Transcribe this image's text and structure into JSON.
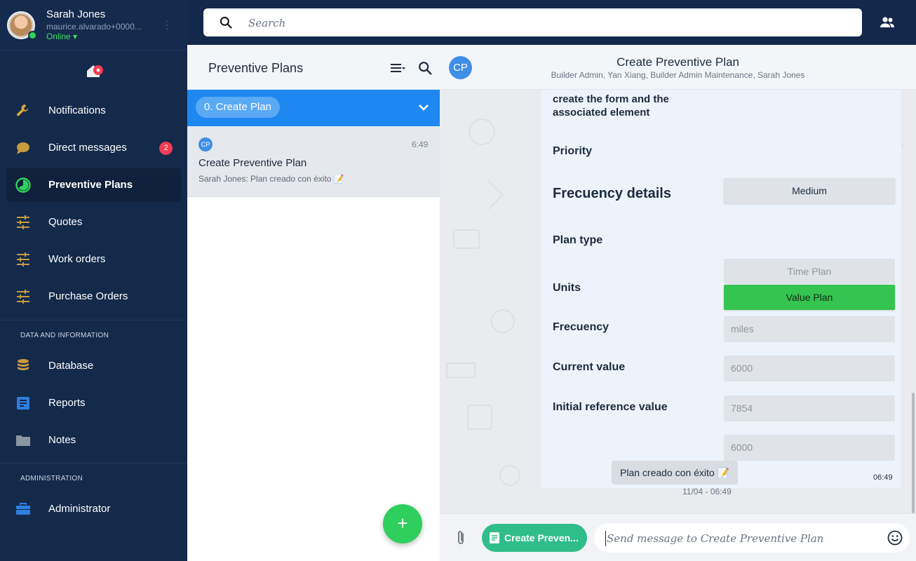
{
  "profile": {
    "name": "Sarah Jones",
    "email": "maurice.alvarado+0000...",
    "status": "Online ▾"
  },
  "search": {
    "placeholder": "Search"
  },
  "sidebar": {
    "items": [
      {
        "label": "Notifications",
        "icon": "wrench-icon"
      },
      {
        "label": "Direct messages",
        "icon": "chat-bubble-icon",
        "badge": "2"
      },
      {
        "label": "Preventive Plans",
        "icon": "preventive-plans-icon",
        "active": true
      },
      {
        "label": "Quotes",
        "icon": "sliders-icon"
      },
      {
        "label": "Work orders",
        "icon": "sliders-icon"
      },
      {
        "label": "Purchase Orders",
        "icon": "sliders-icon"
      }
    ],
    "section_data": "DATA AND INFORMATION",
    "data_items": [
      {
        "label": "Database",
        "icon": "database-icon"
      },
      {
        "label": "Reports",
        "icon": "document-icon"
      },
      {
        "label": "Notes",
        "icon": "folder-icon"
      }
    ],
    "section_admin": "ADMINISTRATION",
    "admin_items": [
      {
        "label": "Administrator",
        "icon": "toolbox-icon"
      }
    ]
  },
  "channel_list": {
    "title": "Preventive Plans",
    "group": "0. Create Plan",
    "chat": {
      "avatar": "CP",
      "time": "6:49",
      "title": "Create Preventive Plan",
      "preview": "Sarah Jones: Plan creado con éxito 📝"
    },
    "fab": "+"
  },
  "conversation": {
    "avatar": "CP",
    "title": "Create Preventive Plan",
    "members": "Builder Admin, Yan Xiang, Builder Admin Maintenance, Sarah Jones",
    "card": {
      "text_line1": "create the form and the",
      "text_line2": "associated element",
      "priority_label": "Priority",
      "priority_value": "Medium",
      "section_title": "Frecuency details",
      "plan_type_label": "Plan type",
      "plan_type_option1": "Time Plan",
      "plan_type_option2": "Value Plan",
      "units_label": "Units",
      "units_value": "miles",
      "frecuency_label": "Frecuency",
      "frecuency_value": "6000",
      "current_value_label": "Current value",
      "current_value": "7854",
      "initial_ref_label": "Initial reference value",
      "initial_ref_value": "6000",
      "time": "06:49"
    },
    "system_message": "Plan creado con éxito 📝",
    "system_time": "11/04 - 06:49"
  },
  "composer": {
    "form_chip": "Create Preven...",
    "placeholder": "Send message to Create Preventive Plan"
  },
  "colors": {
    "sidebar_bg": "#132a4b",
    "accent_blue": "#1f87f0",
    "accent_green": "#35c44f",
    "badge_red": "#f23b52",
    "form_chip": "#30bd8a"
  }
}
